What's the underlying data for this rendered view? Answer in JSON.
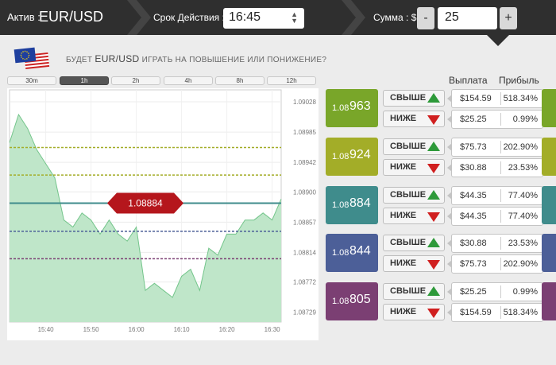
{
  "top": {
    "asset_label": "Актив :",
    "asset": "EUR/USD",
    "expiry_label": "Срок Действия :",
    "expiry": "16:45",
    "sum_label": "Сумма : $",
    "minus": "-",
    "amount": "25",
    "plus": "+"
  },
  "question": {
    "prefix": "БУДЕТ",
    "pair": "EUR/USD",
    "suffix": "ИГРАТЬ НА ПОВЫШЕНИЕ ИЛИ ПОНИЖЕНИЕ?"
  },
  "tabs": [
    "30m",
    "1h",
    "2h",
    "4h",
    "8h",
    "12h"
  ],
  "active_tab": "1h",
  "chart_data": {
    "type": "area",
    "current_price": "1.08884",
    "y_ticks": [
      "1.09028",
      "1.08985",
      "1.08942",
      "1.08900",
      "1.08857",
      "1.08814",
      "1.08772",
      "1.08729"
    ],
    "x_ticks": [
      "15:40",
      "15:50",
      "16:00",
      "16:10",
      "16:20",
      "16:30"
    ],
    "x": [
      "15:32",
      "15:34",
      "15:36",
      "15:38",
      "15:40",
      "15:42",
      "15:44",
      "15:46",
      "15:48",
      "15:50",
      "15:52",
      "15:54",
      "15:56",
      "15:58",
      "16:00",
      "16:02",
      "16:04",
      "16:06",
      "16:08",
      "16:10",
      "16:12",
      "16:14",
      "16:16",
      "16:18",
      "16:20",
      "16:22",
      "16:24",
      "16:26",
      "16:28",
      "16:30",
      "16:32"
    ],
    "values": [
      1.0897,
      1.0901,
      1.0899,
      1.0896,
      1.0894,
      1.0892,
      1.0886,
      1.0885,
      1.0887,
      1.0886,
      1.0884,
      1.0886,
      1.0884,
      1.0883,
      1.0885,
      1.0876,
      1.0877,
      1.0876,
      1.0875,
      1.0878,
      1.0879,
      1.0876,
      1.0882,
      1.0881,
      1.0884,
      1.0884,
      1.0886,
      1.0886,
      1.0887,
      1.0886,
      1.0889
    ],
    "ylim": [
      1.08715,
      1.09045
    ],
    "levels": [
      {
        "price": 1.08963,
        "color": "#a3ad28"
      },
      {
        "price": 1.08924,
        "color": "#a3ad28"
      },
      {
        "price": 1.08884,
        "color": "#3f8c8c"
      },
      {
        "price": 1.08844,
        "color": "#4c5f98"
      },
      {
        "price": 1.08805,
        "color": "#7b3f73"
      }
    ]
  },
  "headers": {
    "payout": "Выплата",
    "profit": "Прибыль"
  },
  "options": [
    {
      "price_small": "1.08",
      "price_big": "963",
      "color": "#79a629",
      "up_label": "СВЫШЕ",
      "up_payout": "$154.59",
      "up_profit": "518.34%",
      "down_label": "НИЖЕ",
      "down_payout": "$25.25",
      "down_profit": "0.99%"
    },
    {
      "price_small": "1.08",
      "price_big": "924",
      "color": "#a3ad28",
      "up_label": "СВЫШЕ",
      "up_payout": "$75.73",
      "up_profit": "202.90%",
      "down_label": "НИЖЕ",
      "down_payout": "$30.88",
      "down_profit": "23.53%"
    },
    {
      "price_small": "1.08",
      "price_big": "884",
      "color": "#3f8c8c",
      "up_label": "СВЫШЕ",
      "up_payout": "$44.35",
      "up_profit": "77.40%",
      "down_label": "НИЖЕ",
      "down_payout": "$44.35",
      "down_profit": "77.40%"
    },
    {
      "price_small": "1.08",
      "price_big": "844",
      "color": "#4c5f98",
      "up_label": "СВЫШЕ",
      "up_payout": "$30.88",
      "up_profit": "23.53%",
      "down_label": "НИЖЕ",
      "down_payout": "$75.73",
      "down_profit": "202.90%"
    },
    {
      "price_small": "1.08",
      "price_big": "805",
      "color": "#7b3f73",
      "up_label": "СВЫШЕ",
      "up_payout": "$25.25",
      "up_profit": "0.99%",
      "down_label": "НИЖЕ",
      "down_payout": "$154.59",
      "down_profit": "518.34%"
    }
  ]
}
